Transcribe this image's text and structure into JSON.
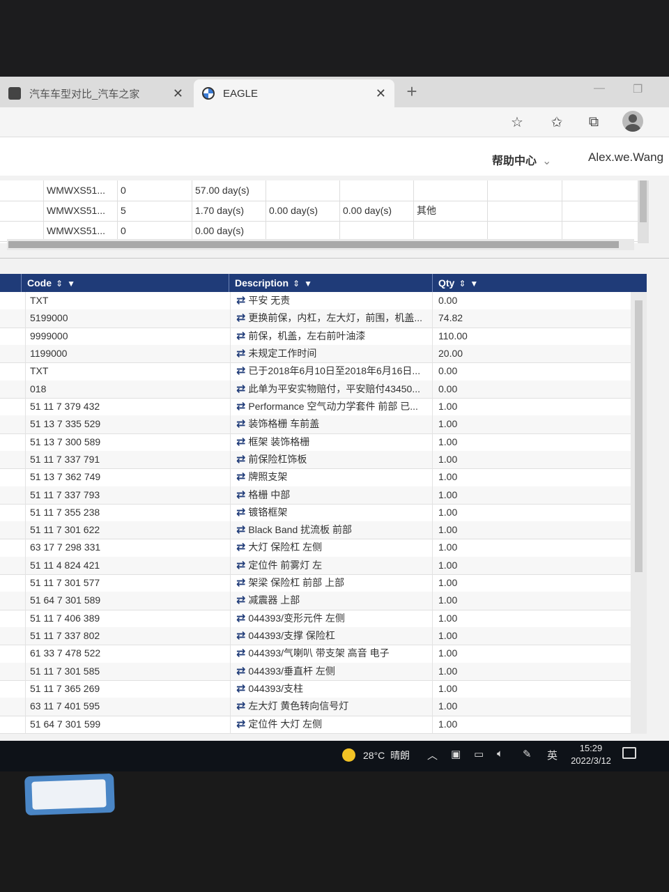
{
  "browser": {
    "tabs": [
      {
        "title": "汽车车型对比_汽车之家",
        "active": false
      },
      {
        "title": "EAGLE",
        "active": true
      }
    ],
    "new_tab_symbol": "+",
    "close_symbol": "✕"
  },
  "toolbar": {
    "icons": [
      "add-favorite-icon",
      "favorites-icon",
      "collections-icon",
      "profile-avatar"
    ]
  },
  "app_header": {
    "help_center": "帮助中心",
    "user_name": "Alex.we.Wang"
  },
  "upper_grid": {
    "rows": [
      {
        "vin": "WMWXS51...",
        "count": "0",
        "d1": "57.00 day(s)",
        "d2": "",
        "d3": "",
        "note": ""
      },
      {
        "vin": "WMWXS51...",
        "count": "5",
        "d1": "1.70 day(s)",
        "d2": "0.00 day(s)",
        "d3": "0.00 day(s)",
        "note": "其他"
      },
      {
        "vin": "WMWXS51...",
        "count": "0",
        "d1": "0.00 day(s)",
        "d2": "",
        "d3": "",
        "note": ""
      }
    ]
  },
  "items_grid": {
    "columns": {
      "code": "Code",
      "description": "Description",
      "qty": "Qty"
    },
    "sort_icon": "⇕",
    "filter_icon": "▼",
    "rows": [
      {
        "code": "TXT",
        "desc": "平安 无责",
        "qty": "0.00"
      },
      {
        "code": "5199000",
        "desc": "更换前保，内杠，左大灯，前围，机盖...",
        "qty": "74.82"
      },
      {
        "code": "9999000",
        "desc": "前保，机盖，左右前叶油漆",
        "qty": "110.00"
      },
      {
        "code": "1199000",
        "desc": "未规定工作时间",
        "qty": "20.00"
      },
      {
        "code": "TXT",
        "desc": "已于2018年6月10日至2018年6月16日...",
        "qty": "0.00"
      },
      {
        "code": "018",
        "desc": "此单为平安实物赔付，平安赔付43450...",
        "qty": "0.00"
      },
      {
        "code": "51 11 7 379 432",
        "desc": "Performance 空气动力学套件 前部 已...",
        "qty": "1.00"
      },
      {
        "code": "51 13 7 335 529",
        "desc": "装饰格栅 车前盖",
        "qty": "1.00"
      },
      {
        "code": "51 13 7 300 589",
        "desc": "框架 装饰格栅",
        "qty": "1.00"
      },
      {
        "code": "51 11 7 337 791",
        "desc": "前保险杠饰板",
        "qty": "1.00"
      },
      {
        "code": "51 13 7 362 749",
        "desc": "牌照支架",
        "qty": "1.00"
      },
      {
        "code": "51 11 7 337 793",
        "desc": "格栅 中部",
        "qty": "1.00"
      },
      {
        "code": "51 11 7 355 238",
        "desc": "镀铬框架",
        "qty": "1.00"
      },
      {
        "code": "51 11 7 301 622",
        "desc": "Black Band 扰流板 前部",
        "qty": "1.00"
      },
      {
        "code": "63 17 7 298 331",
        "desc": "大灯 保险杠 左侧",
        "qty": "1.00"
      },
      {
        "code": "51 11 4 824 421",
        "desc": "定位件 前雾灯 左",
        "qty": "1.00"
      },
      {
        "code": "51 11 7 301 577",
        "desc": "架梁 保险杠 前部 上部",
        "qty": "1.00"
      },
      {
        "code": "51 64 7 301 589",
        "desc": "减震器 上部",
        "qty": "1.00"
      },
      {
        "code": "51 11 7 406 389",
        "desc": "044393/变形元件 左侧",
        "qty": "1.00"
      },
      {
        "code": "51 11 7 337 802",
        "desc": "044393/支撑 保险杠",
        "qty": "1.00"
      },
      {
        "code": "61 33 7 478 522",
        "desc": "044393/气喇叭 带支架 高音 电子",
        "qty": "1.00"
      },
      {
        "code": "51 11 7 301 585",
        "desc": "044393/垂直杆 左侧",
        "qty": "1.00"
      },
      {
        "code": "51 11 7 365 269",
        "desc": "044393/支柱",
        "qty": "1.00"
      },
      {
        "code": "63 11 7 401 595",
        "desc": "左大灯 黄色转向信号灯",
        "qty": "1.00"
      },
      {
        "code": "51 64 7 301 599",
        "desc": "定位件 大灯 左侧",
        "qty": "1.00"
      }
    ]
  },
  "taskbar": {
    "weather_temp": "28°C",
    "weather_text": "晴朗",
    "ime": "英",
    "time": "15:29",
    "date": "2022/3/12"
  }
}
